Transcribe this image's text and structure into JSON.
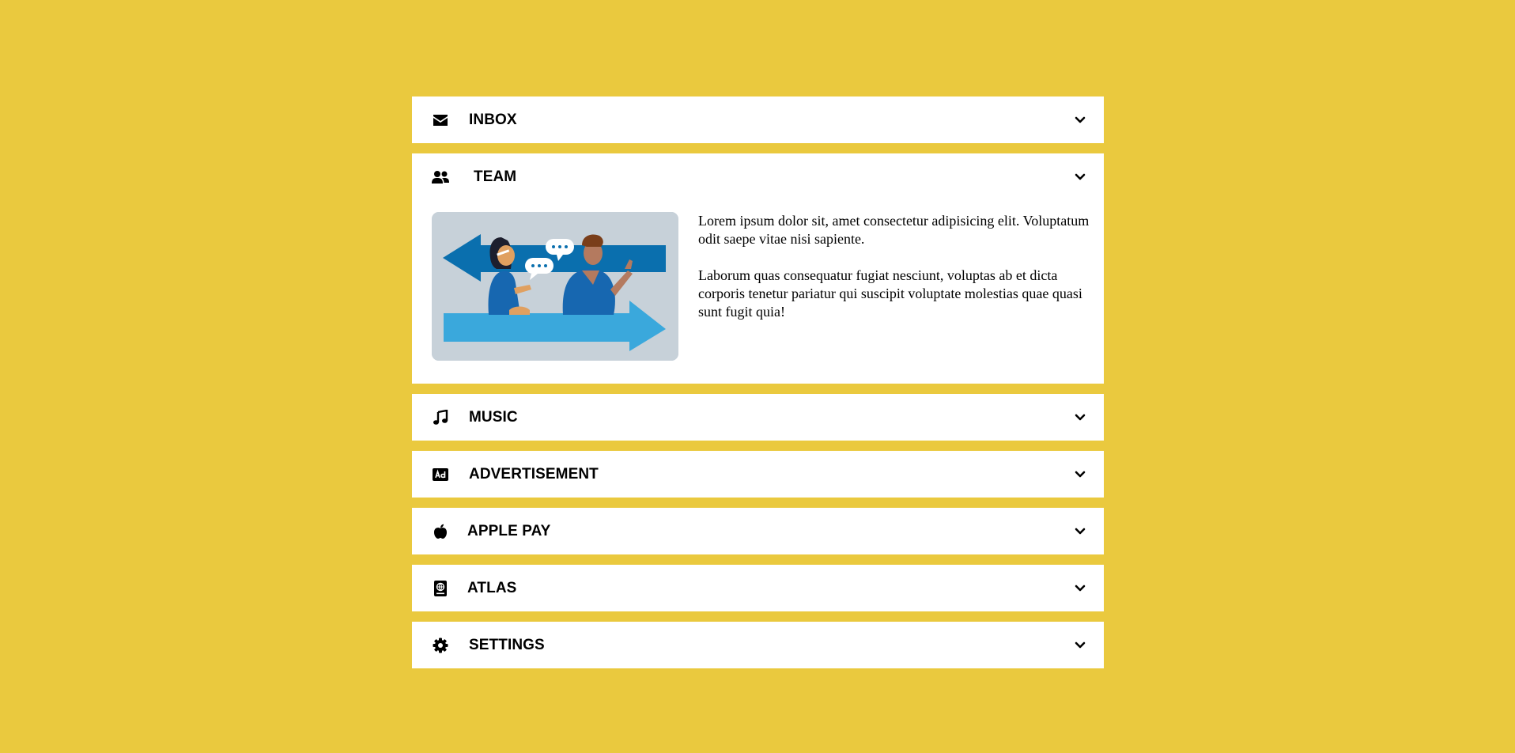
{
  "accordion": {
    "items": [
      {
        "label": "INBOX",
        "icon": "envelope-icon",
        "expanded": false
      },
      {
        "label": "TEAM",
        "icon": "users-icon",
        "expanded": true
      },
      {
        "label": "MUSIC",
        "icon": "music-note-icon",
        "expanded": false
      },
      {
        "label": "ADVERTISEMENT",
        "icon": "ad-icon",
        "expanded": false
      },
      {
        "label": "APPLE PAY",
        "icon": "apple-icon",
        "expanded": false
      },
      {
        "label": "ATLAS",
        "icon": "atlas-icon",
        "expanded": false
      },
      {
        "label": "SETTINGS",
        "icon": "gear-icon",
        "expanded": false
      }
    ],
    "team_panel": {
      "paragraph_1": "Lorem ipsum dolor sit, amet consectetur adipisicing elit. Voluptatum odit saepe vitae nisi sapiente.",
      "paragraph_2": "Laborum quas consequatur fugiat nesciunt, voluptas ab et dicta corporis tenetur pariatur qui suscipit voluptate molestias quae quasi sunt fugit quia!"
    }
  },
  "colors": {
    "background": "#eac93e",
    "panel": "#ffffff",
    "text": "#000000",
    "arrow_dark": "#0a6fae",
    "arrow_light": "#3aa8dc",
    "illustration_bg": "#c7d1d9"
  }
}
